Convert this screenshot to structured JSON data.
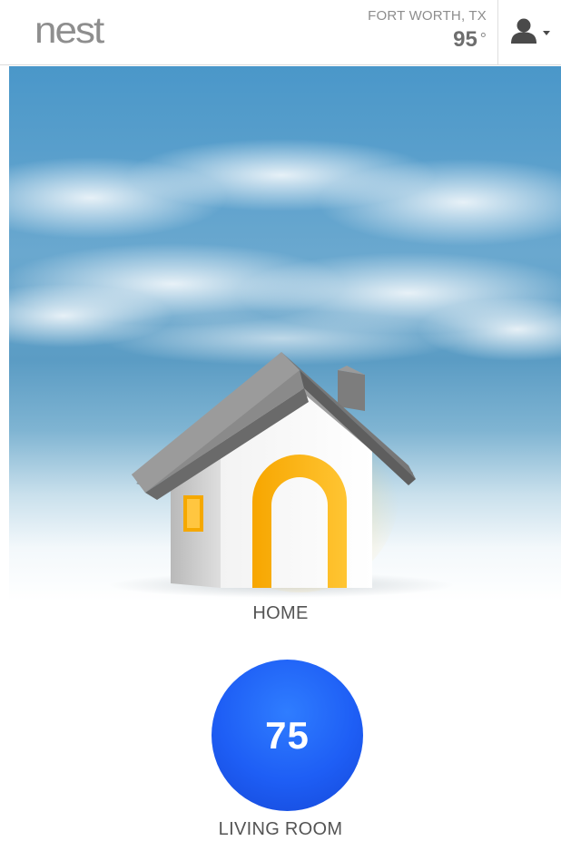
{
  "header": {
    "logo_text": "nest",
    "weather": {
      "location": "FORT WORTH, TX",
      "temperature": "95",
      "degree_symbol": "°"
    },
    "account_icon": "user-icon",
    "account_caret_icon": "caret-down-icon"
  },
  "structure": {
    "name": "HOME",
    "icon": "house-icon",
    "away": false
  },
  "thermostats": [
    {
      "target_temperature": "75",
      "room_name": "LIVING ROOM",
      "mode_color": "#1e5ef5"
    }
  ],
  "colors": {
    "accent": "#f5a800",
    "sky_top": "#3a8cc4",
    "thermostat_blue": "#1e5ef5"
  }
}
